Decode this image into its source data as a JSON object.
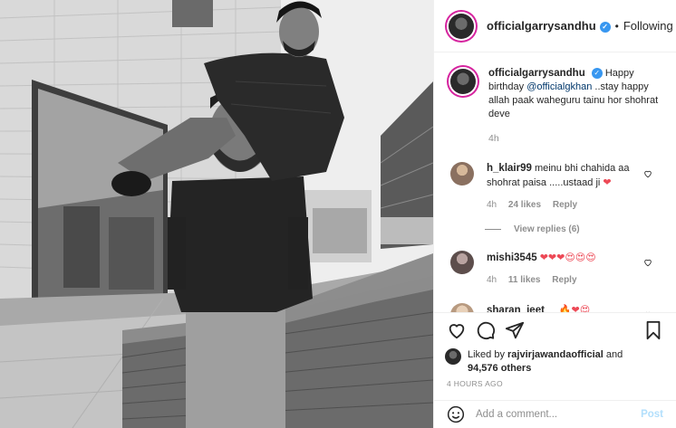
{
  "post": {
    "username": "officialgarrysandhu",
    "following_label": "Following",
    "dot": "•",
    "verified_mark": "✓"
  },
  "caption": {
    "username": "officialgarrysandhu",
    "text_before": "Happy birthday ",
    "mention": "@officialgkhan",
    "text_after": " ..stay happy allah paak waheguru tainu hor shohrat deve",
    "time": "4h"
  },
  "comments": [
    {
      "username": "h_klair99",
      "text": "meinu bhi chahida aa shohrat paisa .....ustaad ji",
      "emoji": "❤",
      "time": "4h",
      "likes": "24 likes",
      "reply": "Reply",
      "view_replies": "View replies (6)"
    },
    {
      "username": "mishi3545",
      "text": "",
      "emoji": "❤❤❤😍😍😍",
      "time": "4h",
      "likes": "11 likes",
      "reply": "Reply"
    },
    {
      "username": "sharan_jeet__",
      "text": "",
      "emoji": "🔥❤😍"
    }
  ],
  "likes": {
    "prefix": "Liked by ",
    "user": "rajvirjawandaofficial",
    "and": " and",
    "count": "94,576 others"
  },
  "post_time": "4 HOURS AGO",
  "add_comment": {
    "placeholder": "Add a comment...",
    "post_label": "Post"
  },
  "icons": {
    "like": "heart-icon",
    "comment": "comment-icon",
    "share": "share-icon",
    "save": "bookmark-icon",
    "emoji": "smiley-icon"
  },
  "colors": {
    "verified": "#3897f0",
    "heart": "#ed4956",
    "link": "#00376b",
    "post_disabled": "#b2dffc"
  }
}
